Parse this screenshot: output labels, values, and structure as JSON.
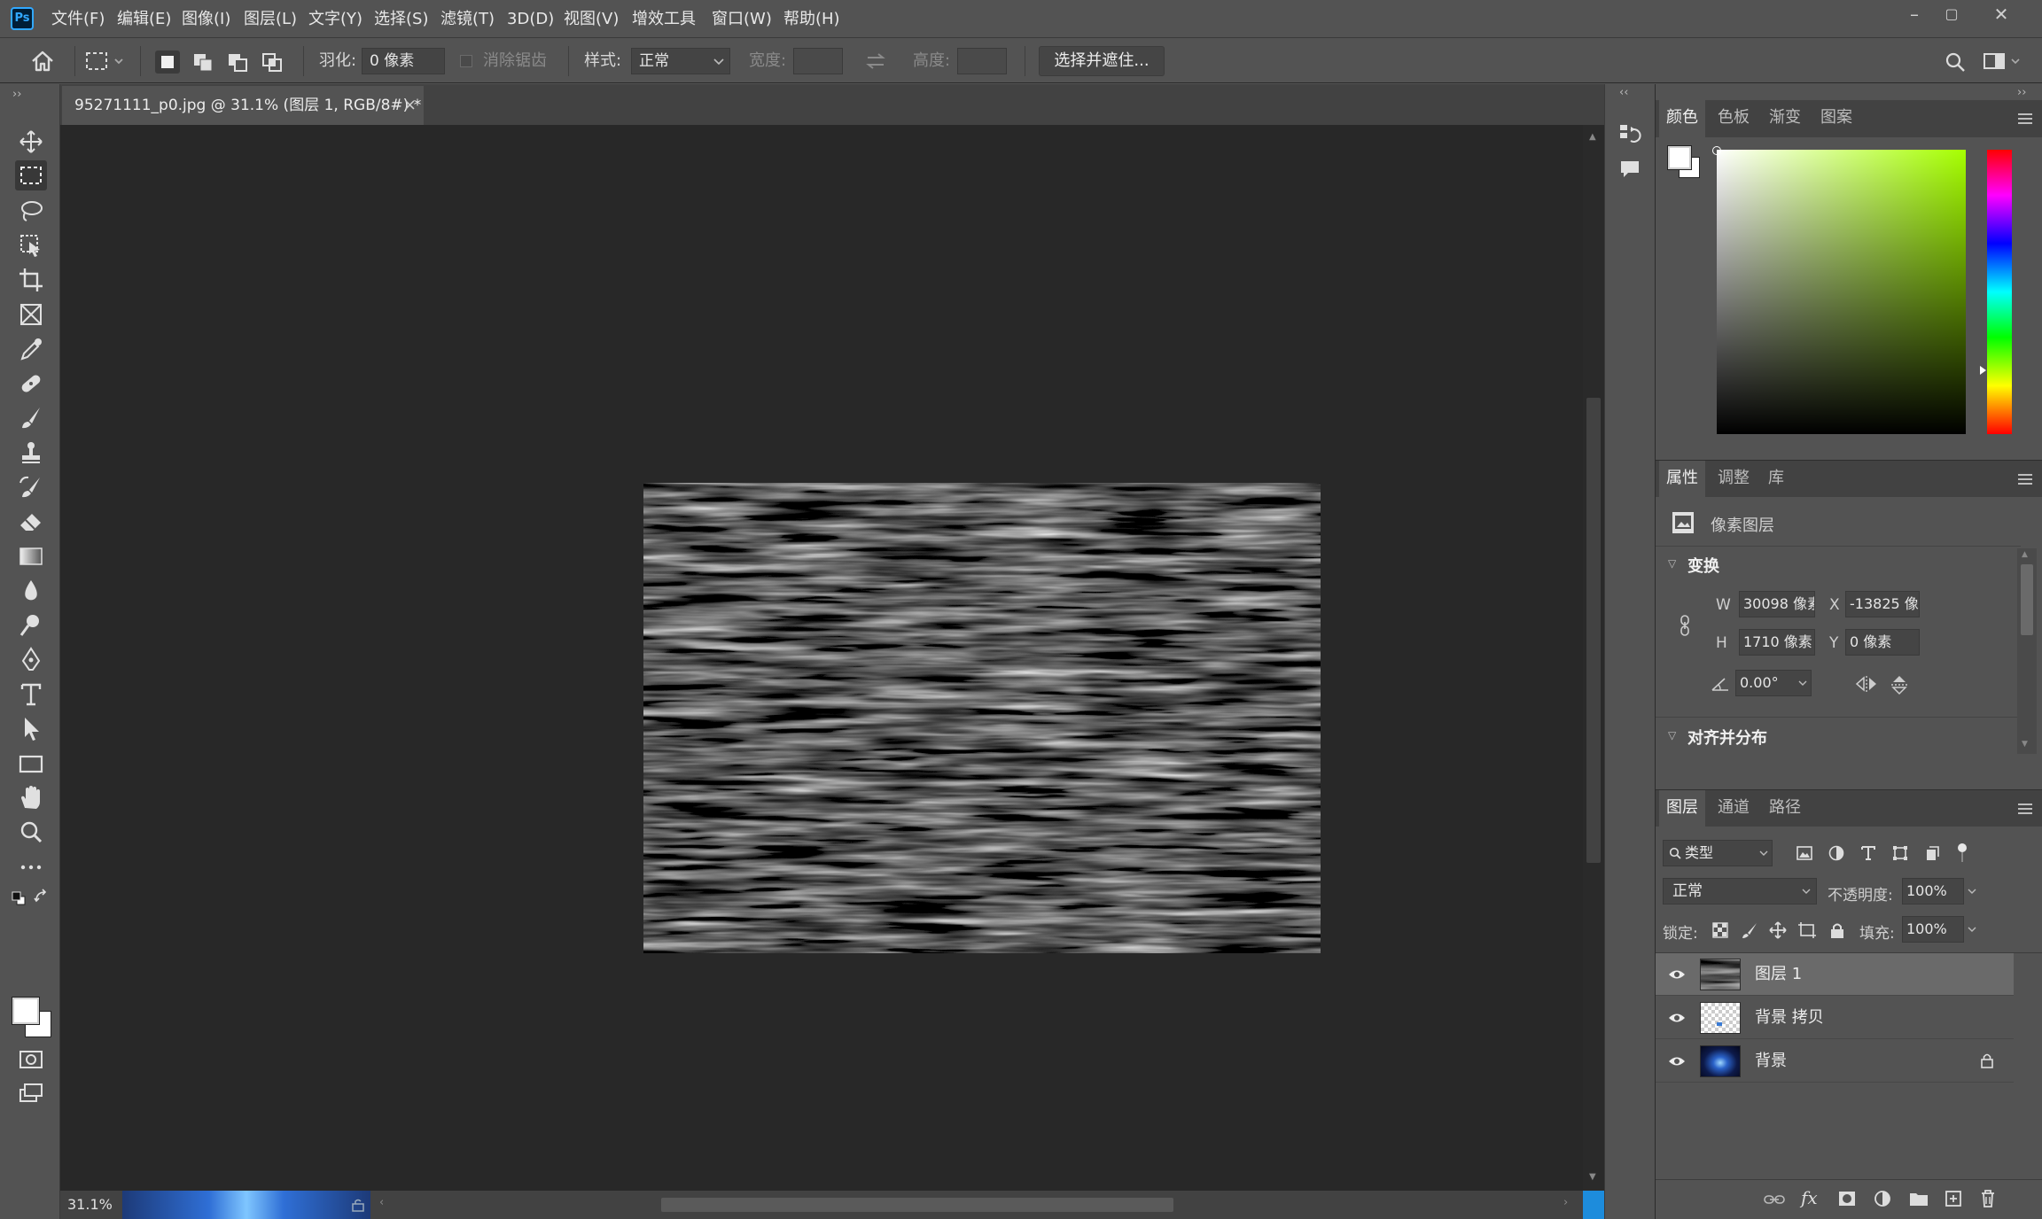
{
  "app": {
    "logo": "Ps"
  },
  "menu": [
    "文件(F)",
    "编辑(E)",
    "图像(I)",
    "图层(L)",
    "文字(Y)",
    "选择(S)",
    "滤镜(T)",
    "3D(D)",
    "视图(V)",
    "增效工具",
    "窗口(W)",
    "帮助(H)"
  ],
  "window_controls": {
    "minimize": "–",
    "maximize": "▢",
    "close": "✕"
  },
  "options": {
    "feather_label": "羽化:",
    "feather_value": "0 像素",
    "antialias_label": "消除锯齿",
    "style_label": "样式:",
    "style_value": "正常",
    "width_label": "宽度:",
    "height_label": "高度:",
    "select_mask_button": "选择并遮住..."
  },
  "document": {
    "tab_title": "95271111_p0.jpg @ 31.1% (图层 1, RGB/8#) *",
    "close": "×",
    "zoom": "31.1%"
  },
  "panels": {
    "color_tabs": [
      "颜色",
      "色板",
      "渐变",
      "图案"
    ],
    "properties_tabs": [
      "属性",
      "调整",
      "库"
    ],
    "layer_type": "像素图层",
    "transform": {
      "title": "变换",
      "w_label": "W",
      "w_value": "30098 像素",
      "x_label": "X",
      "x_value": "-13825 像素",
      "h_label": "H",
      "h_value": "1710 像素",
      "y_label": "Y",
      "y_value": "0 像素",
      "angle_value": "0.00°"
    },
    "align_title": "对齐并分布",
    "layers_tabs": [
      "图层",
      "通道",
      "路径"
    ],
    "filter_kind": "类型",
    "blend_mode": "正常",
    "opacity_label": "不透明度:",
    "opacity_value": "100%",
    "lock_label": "锁定:",
    "fill_label": "填充:",
    "fill_value": "100%",
    "layers": [
      {
        "name": "图层 1",
        "selected": true
      },
      {
        "name": "背景 拷贝",
        "selected": false
      },
      {
        "name": "背景",
        "selected": false,
        "locked": true
      }
    ]
  },
  "icons": [
    "ps-logo",
    "home-icon",
    "marquee-icon",
    "move-icon",
    "lasso-icon",
    "crop-icon",
    "eyedropper-icon",
    "brush-icon",
    "eraser-icon",
    "type-icon",
    "hand-icon",
    "zoom-icon",
    "search-icon",
    "eye-icon",
    "lock-icon",
    "link-icon",
    "fx-icon",
    "trash-icon"
  ],
  "colors": {
    "ui_bg": "#535353",
    "canvas_bg": "#282828",
    "accent": "#31a8ff"
  }
}
